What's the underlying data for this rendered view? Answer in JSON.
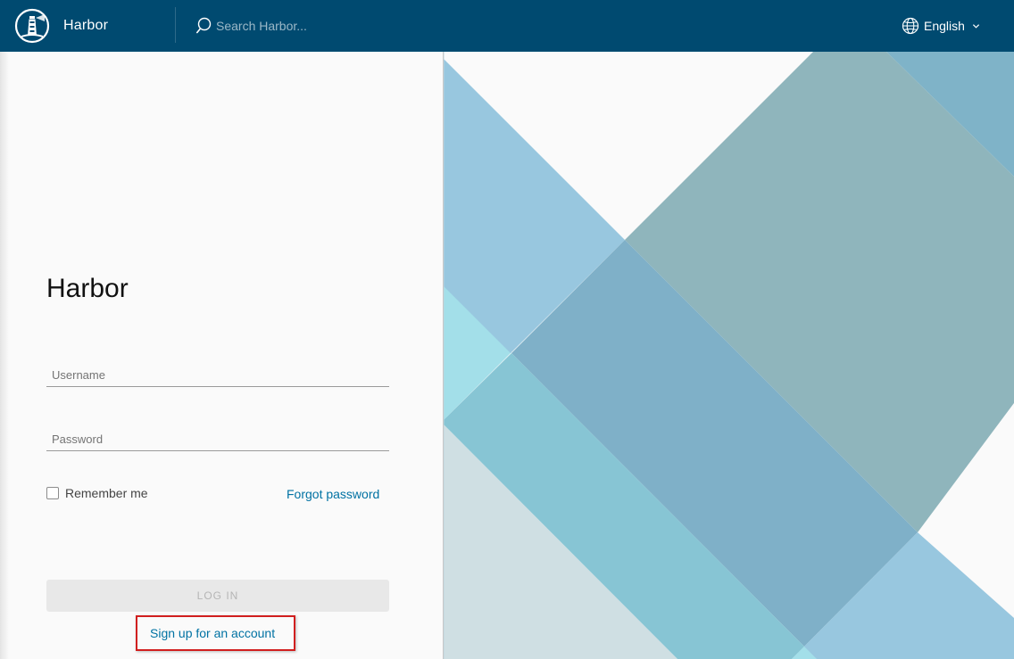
{
  "header": {
    "brand_title": "Harbor",
    "search_placeholder": "Search Harbor...",
    "language": "English"
  },
  "login": {
    "title": "Harbor",
    "username_placeholder": "Username",
    "password_placeholder": "Password",
    "remember_label": "Remember me",
    "forgot_label": "Forgot password",
    "login_label": "LOG IN",
    "signup_label": "Sign up for an account"
  },
  "colors": {
    "header_bg": "#004a70",
    "link": "#0072a3",
    "highlight_box": "#d11f1f"
  },
  "icons": {
    "logo": "harbor-lighthouse-logo",
    "search": "search-icon",
    "language": "globe-icon",
    "dropdown": "chevron-down-icon"
  }
}
